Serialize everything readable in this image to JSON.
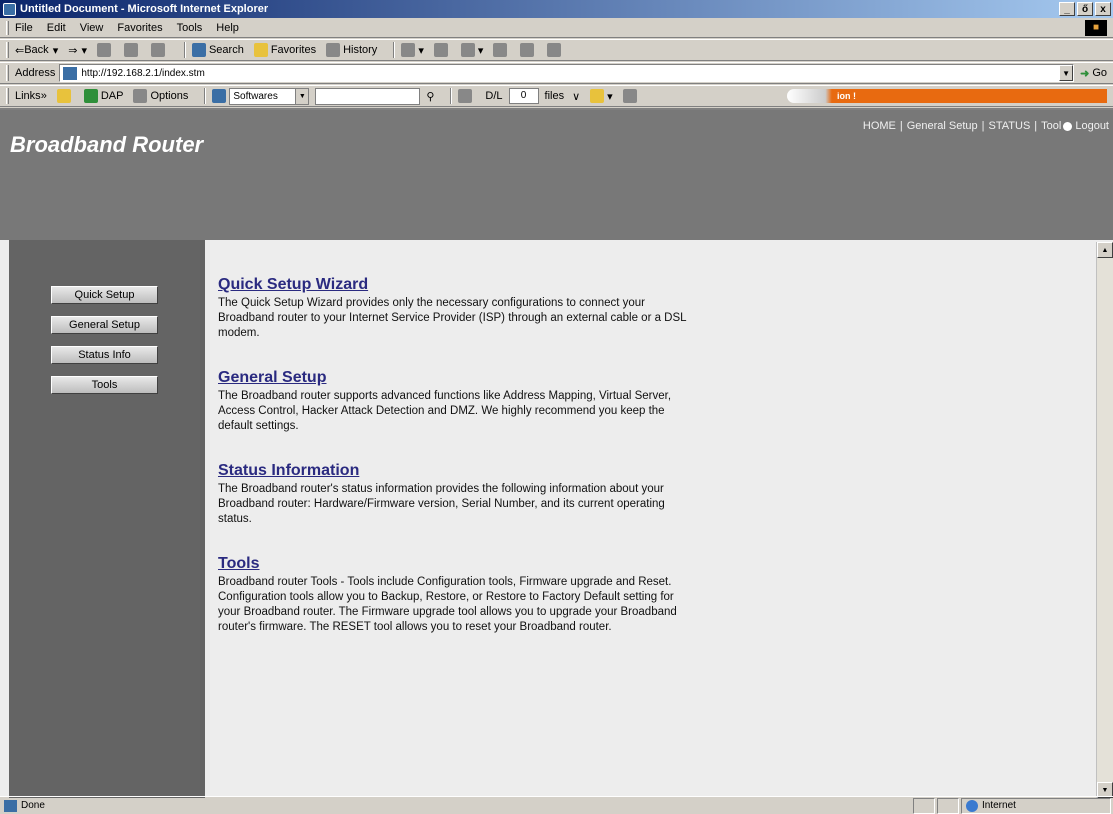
{
  "window": {
    "title": "Untitled Document - Microsoft Internet Explorer",
    "controls": [
      "_",
      "ő",
      "x"
    ]
  },
  "menu": [
    "File",
    "Edit",
    "View",
    "Favorites",
    "Tools",
    "Help"
  ],
  "toolbar": {
    "back": "Back",
    "search": "Search",
    "favorites": "Favorites",
    "history": "History"
  },
  "address": {
    "label": "Address",
    "url": "http://192.168.2.1/index.stm",
    "go": "Go"
  },
  "links_bar": {
    "label": "Links",
    "dap": "DAP",
    "options": "Options",
    "softwares": "Softwares",
    "dl_label": "D/L",
    "dl_count": "0",
    "files": "files",
    "progress_text": "ion !"
  },
  "page": {
    "brand": "Broadband Router",
    "topnav": [
      "HOME",
      "General Setup",
      "STATUS",
      "Tool",
      "Logout"
    ],
    "sidebar": [
      "Quick Setup",
      "General Setup",
      "Status Info",
      "Tools"
    ],
    "sections": [
      {
        "title": "Quick Setup Wizard",
        "body": "The Quick Setup Wizard provides only the necessary configurations to connect your Broadband router to your Internet Service Provider (ISP) through an external cable or a DSL modem."
      },
      {
        "title": "General Setup",
        "body": "The Broadband router supports advanced functions like Address Mapping, Virtual Server, Access Control, Hacker Attack Detection and DMZ. We highly recommend you keep the default settings."
      },
      {
        "title": "Status Information",
        "body": "The Broadband router's status information provides the following information about your Broadband router: Hardware/Firmware version, Serial Number, and its current operating status."
      },
      {
        "title": "Tools",
        "body": "Broadband router Tools - Tools include Configuration tools, Firmware upgrade and Reset. Configuration tools allow you to Backup, Restore, or Restore to Factory Default setting for your Broadband router. The Firmware upgrade tool allows you to upgrade your Broadband router's firmware. The RESET tool allows you to reset your Broadband router."
      }
    ]
  },
  "status": {
    "text": "Done",
    "zone": "Internet"
  }
}
